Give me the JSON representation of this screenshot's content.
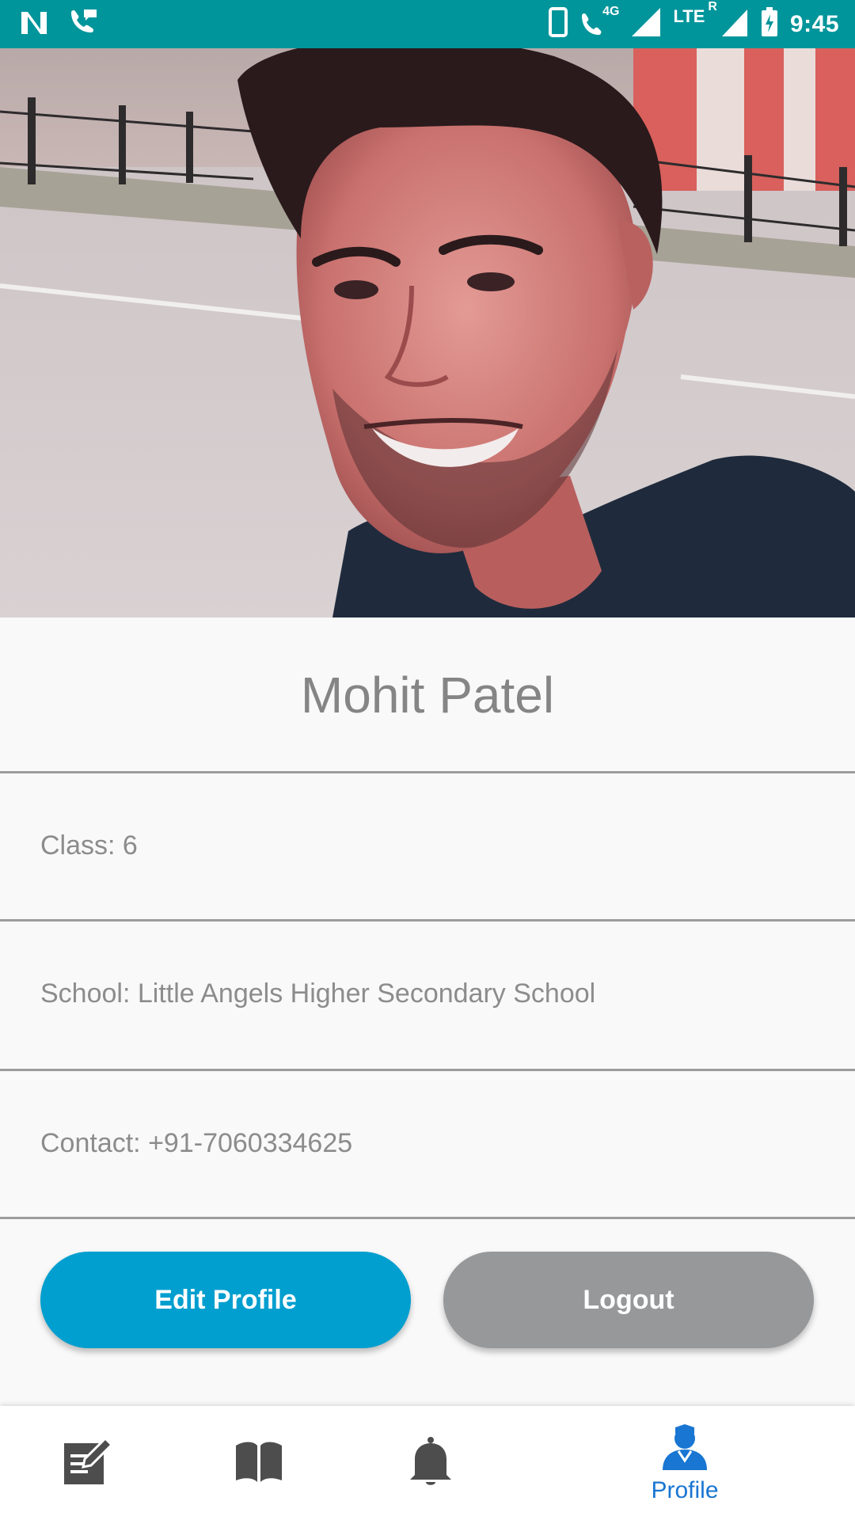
{
  "status_bar": {
    "network_4g": "4G",
    "network_lte": "LTE",
    "roaming": "R",
    "time": "9:45"
  },
  "profile": {
    "name": "Mohit Patel",
    "class_text": "Class: 6",
    "school_text": "School: Little Angels Higher Secondary School",
    "contact_text": "Contact: +91-7060334625"
  },
  "actions": {
    "edit_label": "Edit Profile",
    "logout_label": "Logout"
  },
  "bottom_nav": {
    "items": [
      {
        "icon": "assignment-icon",
        "label": ""
      },
      {
        "icon": "book-icon",
        "label": ""
      },
      {
        "icon": "bell-icon",
        "label": ""
      },
      {
        "icon": "profile-icon",
        "label": "Profile",
        "active": true
      }
    ]
  },
  "colors": {
    "status_bar": "#00959b",
    "edit_button": "#009fcf",
    "logout_button": "#96989a",
    "nav_active": "#1976d2",
    "nav_inactive": "#4d4d4d"
  }
}
